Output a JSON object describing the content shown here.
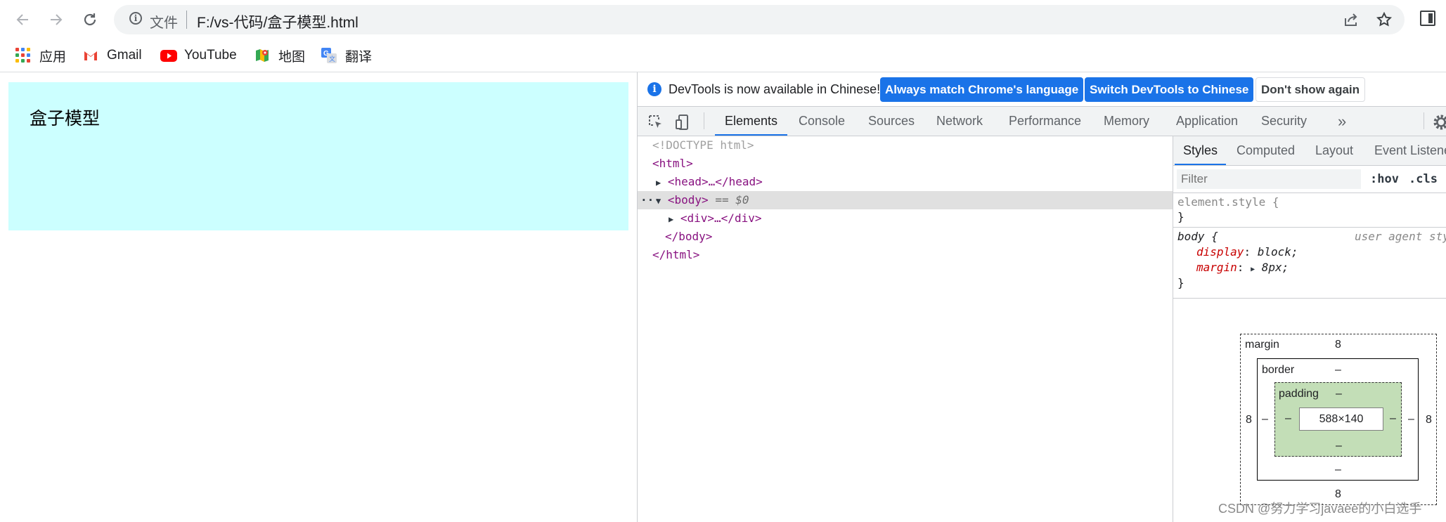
{
  "browser": {
    "back_icon": "arrow-left-icon",
    "forward_icon": "arrow-right-icon",
    "reload_icon": "reload-icon",
    "address": {
      "info_icon": "info-icon",
      "prefix": "文件",
      "url": "F:/vs-代码/盒子模型.html",
      "share_icon": "share-icon",
      "star_icon": "star-icon"
    },
    "side_panel_icon": "side-panel-icon",
    "bookmarks": [
      {
        "label": "应用",
        "icon": "apps-grid-icon"
      },
      {
        "label": "Gmail",
        "icon": "gmail-icon"
      },
      {
        "label": "YouTube",
        "icon": "youtube-icon"
      },
      {
        "label": "地图",
        "icon": "maps-icon"
      },
      {
        "label": "翻译",
        "icon": "translate-icon"
      }
    ]
  },
  "page": {
    "box_text": "盒子模型",
    "box_color": "#ccffff"
  },
  "devtools": {
    "infobar": {
      "message": "DevTools is now available in Chinese!",
      "btn_match": "Always match Chrome's language",
      "btn_switch": "Switch DevTools to Chinese",
      "btn_dismiss": "Don't show again"
    },
    "tabs": [
      "Elements",
      "Console",
      "Sources",
      "Network",
      "Performance",
      "Memory",
      "Application",
      "Security"
    ],
    "more_tabs": "»",
    "dom": {
      "doctype": "<!DOCTYPE html>",
      "html_open": "<html>",
      "head": "<head>…</head>",
      "body_open": "<body>",
      "body_eq": "== $0",
      "div": "<div>…</div>",
      "body_close": "</body>",
      "html_close": "</html>",
      "dots": "···"
    },
    "styles": {
      "tabs": [
        "Styles",
        "Computed",
        "Layout",
        "Event Listeners"
      ],
      "filter_placeholder": "Filter",
      "hov": ":hov",
      ".cls": ".cls",
      "element_style": "element.style {",
      "close_brace": "}",
      "body_selector": "body {",
      "ua_label": "user agent stylesheet",
      "prop1_name": "display",
      "prop1_value": "block;",
      "prop2_name": "margin",
      "prop2_value": "8px;",
      "colon": ":"
    },
    "box_model": {
      "margin_label": "margin",
      "margin_top": "8",
      "margin_bottom": "8",
      "margin_left": "8",
      "margin_right": "8",
      "border_label": "border",
      "border_top": "–",
      "border_bottom": "–",
      "border_left": "–",
      "border_right": "–",
      "padding_label": "padding",
      "padding_top": "–",
      "padding_bottom": "–",
      "padding_left": "–",
      "padding_right": "–",
      "content": "588×140"
    }
  },
  "watermark": "CSDN @努力学习javaee的小白选手"
}
